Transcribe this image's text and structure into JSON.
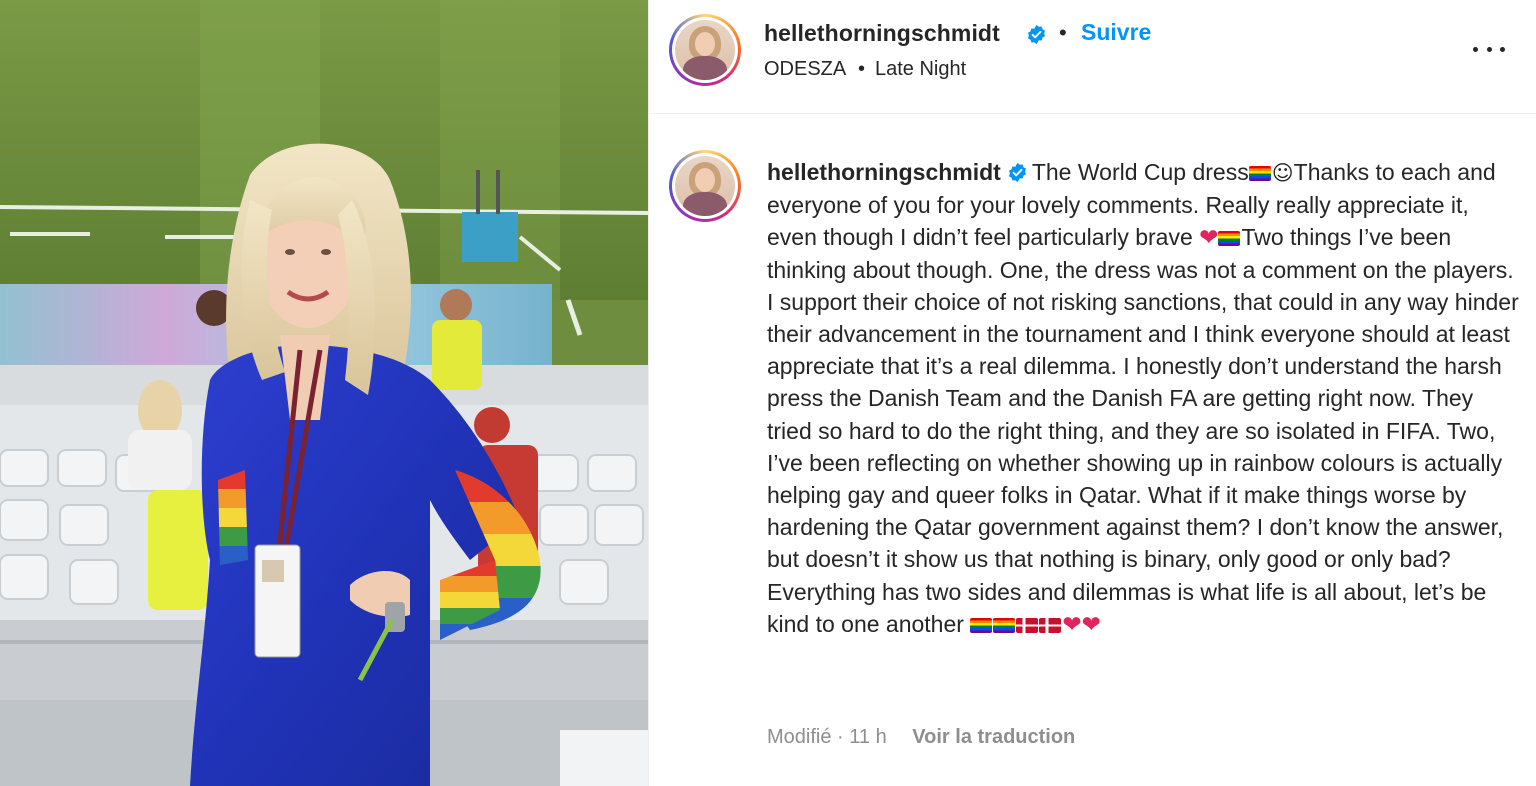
{
  "post": {
    "username": "hellethorningschmidt",
    "follow_label": "Suivre",
    "separator": "•",
    "music_artist": "ODESZA",
    "music_track": "Late Night",
    "more_label": "•••"
  },
  "caption": {
    "username": "hellethorningschmidt",
    "part1": "The World Cup dress",
    "part2": "Thanks to each and everyone of you for your lovely comments. Really really appreciate it, even though I didn’t feel particularly brave ",
    "part3": "Two things I’ve been thinking about though. One, the dress was not a comment on the players. I support their choice of not risking sanctions, that could in any way hinder their advancement in the tournament and I think everyone should at least appreciate that it’s a real dilemma. I honestly don’t understand the harsh press the Danish Team and the Danish FA are getting right now. They tried so hard to do the right thing, and they are so isolated in FIFA. Two, I’ve been reflecting on whether showing up in rainbow colours is actually helping gay and queer folks in Qatar. What if it make things worse by hardening the Qatar government against them? I don’t know the answer, but doesn’t it show us that nothing is binary, only good or only bad? Everything has two sides and dilemmas is what life is all about, let’s be kind to one another ",
    "smile": "☺",
    "heart": "❤"
  },
  "meta": {
    "edited": "Modifié",
    "dot": "·",
    "time": "11 h",
    "translate_label": "Voir la traduction"
  },
  "icons": {
    "verified": "verified-badge-icon",
    "more": "more-options-icon"
  },
  "colors": {
    "link_blue": "#0095f6",
    "verified_blue": "#0095f6",
    "text": "#262626",
    "muted": "#8e8e8e"
  }
}
